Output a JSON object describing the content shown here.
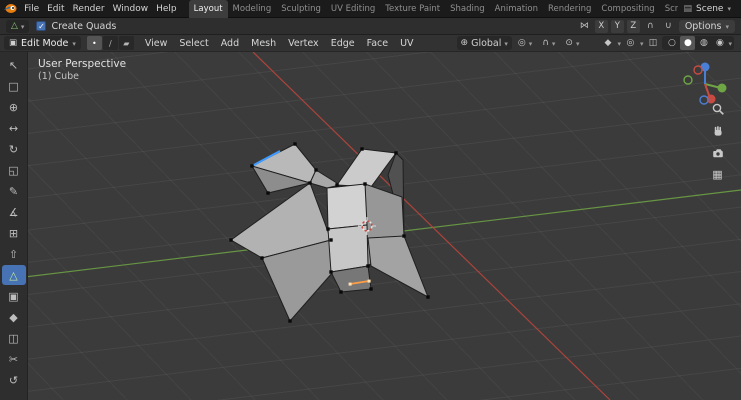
{
  "topbar": {
    "menus": [
      "File",
      "Edit",
      "Render",
      "Window",
      "Help"
    ],
    "workspaces": [
      "Layout",
      "Modeling",
      "Sculpting",
      "UV Editing",
      "Texture Paint",
      "Shading",
      "Animation",
      "Rendering",
      "Compositing",
      "Scripting"
    ],
    "active_workspace": "Layout",
    "new_workspace_label": "+",
    "scene_label": "Scene"
  },
  "tool_settings": {
    "create_quads_label": "Create Quads",
    "create_quads_checked": true,
    "mirror_axes": [
      "X",
      "Y",
      "Z"
    ],
    "options_label": "Options"
  },
  "viewport_header": {
    "mode_label": "Edit Mode",
    "menus": [
      "View",
      "Select",
      "Add",
      "Mesh",
      "Vertex",
      "Edge",
      "Face",
      "UV"
    ],
    "orientation_label": "Global"
  },
  "toolbar": {
    "active_tool": "poly-build",
    "tools": [
      {
        "name": "tweak",
        "glyph": "↖"
      },
      {
        "name": "select-box",
        "glyph": "□"
      },
      {
        "name": "cursor",
        "glyph": "⊕"
      },
      {
        "name": "move",
        "glyph": "↔"
      },
      {
        "name": "rotate",
        "glyph": "↻"
      },
      {
        "name": "scale",
        "glyph": "◱"
      },
      {
        "name": "annotate",
        "glyph": "✎"
      },
      {
        "name": "measure",
        "glyph": "∡"
      },
      {
        "name": "add-cube",
        "glyph": "⊞"
      },
      {
        "name": "extrude-region",
        "glyph": "⇧"
      },
      {
        "name": "poly-build",
        "glyph": "△"
      },
      {
        "name": "inset-faces",
        "glyph": "▣"
      },
      {
        "name": "bevel",
        "glyph": "◆"
      },
      {
        "name": "loop-cut",
        "glyph": "◫"
      },
      {
        "name": "knife",
        "glyph": "✂"
      },
      {
        "name": "spin",
        "glyph": "↺"
      }
    ]
  },
  "viewport": {
    "view_label": "User Perspective",
    "object_label": "(1) Cube",
    "colors": {
      "axis_x": "#b8453c",
      "axis_y": "#6fa545",
      "axis_z": "#4a7fd6",
      "selected_edge": "#ff9d45",
      "seam_edge": "#3d9bff",
      "accent": "#4772b3"
    }
  },
  "icons": {
    "scene": "▤",
    "edit_mode": "▣",
    "vertex_select": "•",
    "edge_select": "∕",
    "face_select": "▰",
    "orientation": "⊕",
    "pivot": "◎",
    "snap_magnet": "∩",
    "proportional": "⊙",
    "mirror": "⋈",
    "active_tool": "△",
    "falloff": "∪",
    "gizmo": "◆",
    "overlays": "◎",
    "xray": "◫",
    "shading_wireframe": "○",
    "shading_solid": "●",
    "shading_material": "◍",
    "shading_rendered": "◉",
    "grid_ortho": "▦"
  }
}
